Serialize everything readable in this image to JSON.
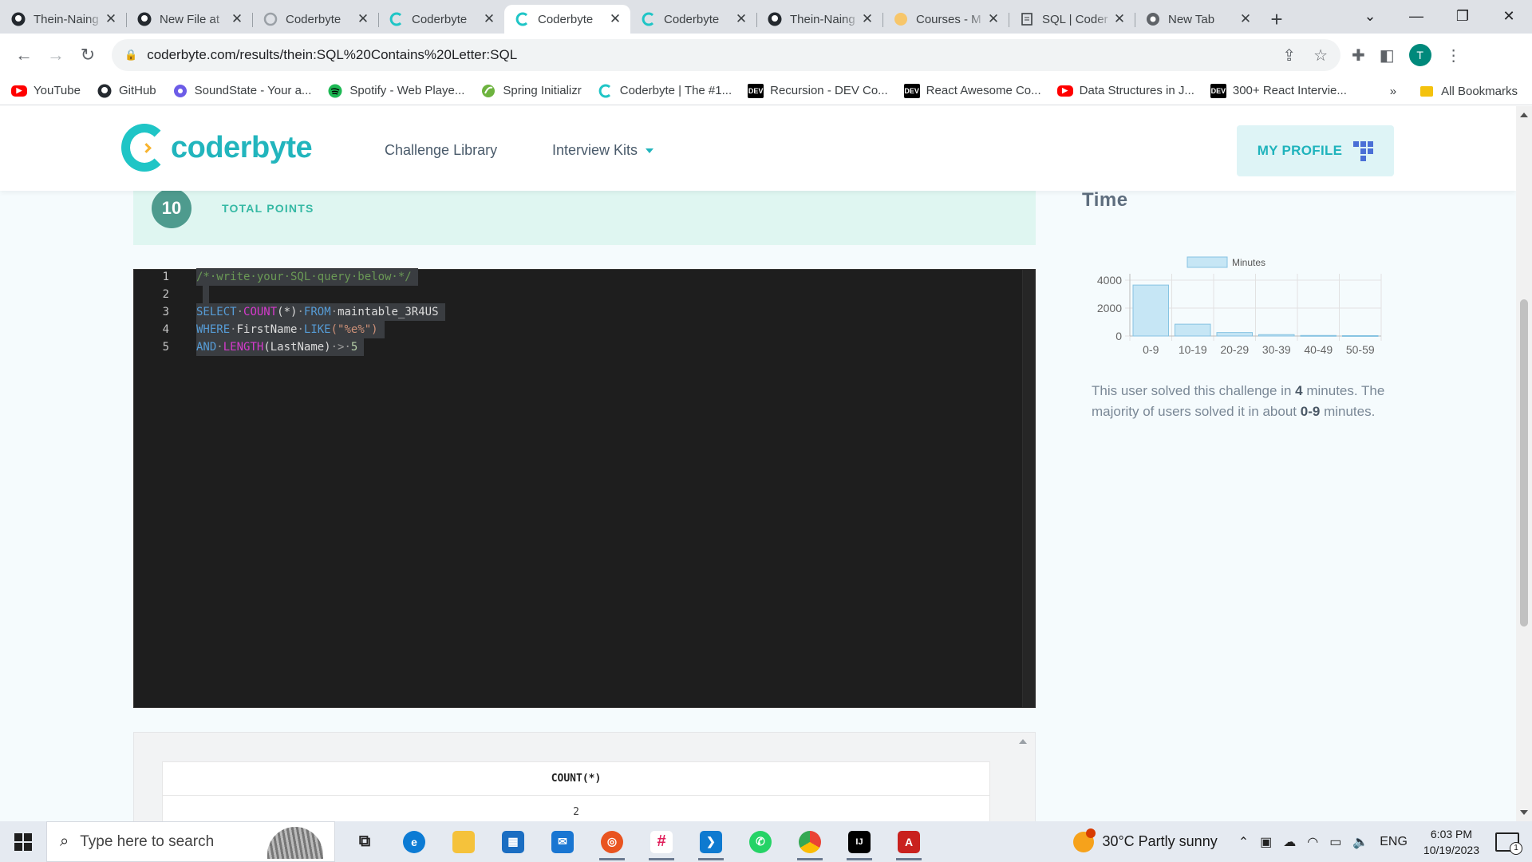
{
  "browser": {
    "tabs": [
      {
        "title": "Thein-Naing",
        "icon": "github-icon"
      },
      {
        "title": "New File at",
        "icon": "github-icon"
      },
      {
        "title": "Coderbyte",
        "icon": "coderbyte-icon"
      },
      {
        "title": "Coderbyte",
        "icon": "coderbyte-icon"
      },
      {
        "title": "Coderbyte",
        "icon": "coderbyte-icon",
        "active": true
      },
      {
        "title": "Coderbyte",
        "icon": "coderbyte-icon"
      },
      {
        "title": "Thein-Naing",
        "icon": "github-icon"
      },
      {
        "title": "Courses - M",
        "icon": "courses-icon"
      },
      {
        "title": "SQL | Coder",
        "icon": "document-icon"
      },
      {
        "title": "New Tab",
        "icon": "chrome-icon"
      }
    ],
    "url": "coderbyte.com/results/thein:SQL%20Contains%20Letter:SQL",
    "profile_initial": "T",
    "bookmarks": [
      {
        "label": "YouTube",
        "icon": "youtube-icon"
      },
      {
        "label": "GitHub",
        "icon": "github-icon"
      },
      {
        "label": "SoundState - Your a...",
        "icon": "soundstate-icon"
      },
      {
        "label": "Spotify - Web Playe...",
        "icon": "spotify-icon"
      },
      {
        "label": "Spring Initializr",
        "icon": "spring-icon"
      },
      {
        "label": "Coderbyte | The #1...",
        "icon": "coderbyte-icon"
      },
      {
        "label": "Recursion - DEV Co...",
        "icon": "dev-icon"
      },
      {
        "label": "React Awesome Co...",
        "icon": "dev-icon"
      },
      {
        "label": "Data Structures in J...",
        "icon": "youtube-icon"
      },
      {
        "label": "300+ React Intervie...",
        "icon": "dev-icon"
      }
    ],
    "bookmarks_overflow": "»",
    "all_bookmarks": "All Bookmarks"
  },
  "site": {
    "logo_text": "coderbyte",
    "nav": {
      "challenge_library": "Challenge Library",
      "interview_kits": "Interview Kits"
    },
    "profile_button": "MY PROFILE"
  },
  "points": {
    "value": "10",
    "label": "TOTAL POINTS"
  },
  "editor": {
    "line_numbers": [
      "1",
      "2",
      "3",
      "4",
      "5"
    ],
    "line1": "/*·write·your·SQL·query·below·*/",
    "line3_kw1": "SELECT",
    "line3_fn": "COUNT",
    "line3_args": "(*)",
    "line3_kw2": "FROM",
    "line3_table": "maintable_3R4US",
    "line4_kw": "WHERE",
    "line4_col": "FirstName",
    "line4_like": "LIKE",
    "line4_str": "(\"%e%\")",
    "line5_kw": "AND",
    "line5_fn": "LENGTH",
    "line5_args": "(LastName)",
    "line5_op": ">",
    "line5_num": "5"
  },
  "result": {
    "column": "COUNT(*)",
    "value": "2"
  },
  "time_panel": {
    "heading": "Time",
    "summary_prefix": "This user solved this challenge in",
    "user_minutes": "4",
    "summary_mid": "minutes. The majority of users solved it in about",
    "majority_range": "0-9",
    "summary_suffix": "minutes."
  },
  "chart_data": {
    "type": "bar",
    "categories": [
      "0-9",
      "10-19",
      "20-29",
      "30-39",
      "40-49",
      "50-59"
    ],
    "series": [
      {
        "name": "Minutes",
        "values": [
          3650,
          850,
          250,
          100,
          40,
          30
        ]
      }
    ],
    "ylim": [
      0,
      4000
    ],
    "yticks": [
      "4000",
      "2000",
      "0"
    ],
    "grid": true,
    "legend": "top",
    "bar_fill": "#c6e6f5",
    "bar_stroke": "#86c3e2"
  },
  "taskbar": {
    "search_placeholder": "Type here to search",
    "apps": [
      "task-view-icon",
      "edge-icon",
      "file-explorer-icon",
      "store-icon",
      "mail-icon",
      "ubuntu-icon",
      "slack-icon",
      "vscode-icon",
      "whatsapp-icon",
      "chrome-icon",
      "intellij-icon",
      "acrobat-icon"
    ],
    "weather": "30°C  Partly sunny",
    "language": "ENG",
    "time": "6:03 PM",
    "date": "10/19/2023",
    "notification_count": "1"
  }
}
